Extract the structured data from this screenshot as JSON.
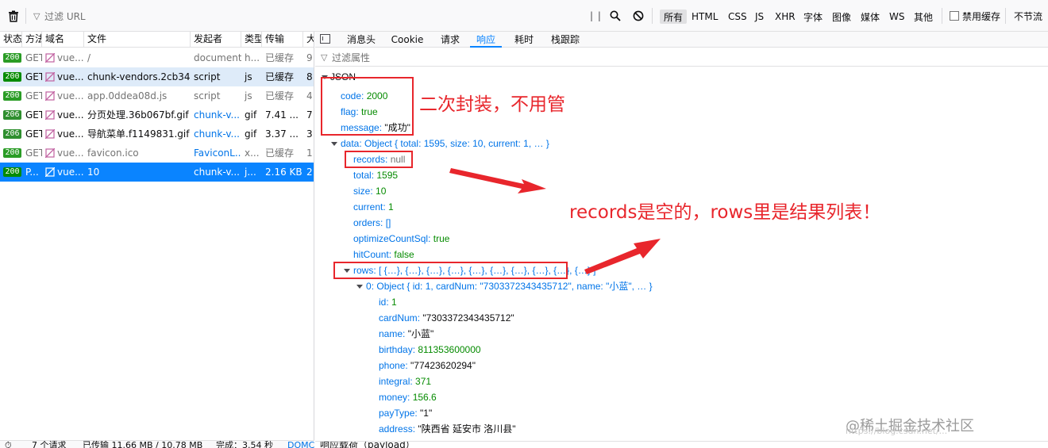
{
  "toolbar": {
    "filter_placeholder": "过滤 URL",
    "types": [
      "所有",
      "HTML",
      "CSS",
      "JS",
      "XHR",
      "字体",
      "图像",
      "媒体",
      "WS",
      "其他"
    ],
    "active_type": "所有",
    "disable_cache": "禁用缓存",
    "throttle": "不节流"
  },
  "table": {
    "headers": [
      "状态",
      "方法",
      "域名",
      "文件",
      "发起者",
      "类型",
      "传输",
      "大小"
    ],
    "rows": [
      {
        "status": "200",
        "method": "GET",
        "domain": "vue...",
        "file": "/",
        "initiator": "document",
        "type": "h...",
        "transfer": "已缓存",
        "size": "9"
      },
      {
        "status": "200",
        "method": "GET",
        "domain": "vue...",
        "file": "chunk-vendors.2cb34c0a.js",
        "initiator": "script",
        "type": "js",
        "transfer": "已缓存",
        "size": "8"
      },
      {
        "status": "200",
        "method": "GET",
        "domain": "vue...",
        "file": "app.0ddea08d.js",
        "initiator": "script",
        "type": "js",
        "transfer": "已缓存",
        "size": "4"
      },
      {
        "status": "206",
        "method": "GET",
        "domain": "vue...",
        "file": "分页处理.36b067bf.gif",
        "initiator": "chunk-v...",
        "type": "gif",
        "transfer": "7.41 ...",
        "size": "7"
      },
      {
        "status": "206",
        "method": "GET",
        "domain": "vue...",
        "file": "导航菜单.f1149831.gif",
        "initiator": "chunk-v...",
        "type": "gif",
        "transfer": "3.37 ...",
        "size": "3"
      },
      {
        "status": "200",
        "method": "GET",
        "domain": "vue...",
        "file": "favicon.ico",
        "initiator": "FaviconL...",
        "type": "x...",
        "transfer": "已缓存",
        "size": "1"
      },
      {
        "status": "200",
        "method": "P...",
        "domain": "vue...",
        "file": "10",
        "initiator": "chunk-v...",
        "type": "j...",
        "transfer": "2.16 KB",
        "size": "2"
      }
    ]
  },
  "statusbar": {
    "requests": "7 个请求",
    "transferred": "已传输 11.66 MB / 10.78 MB",
    "finish": "完成：3.54 秒",
    "domcontent": "DOMC"
  },
  "panel": {
    "tabs": [
      "消息头",
      "Cookie",
      "请求",
      "响应",
      "耗时",
      "栈跟踪"
    ],
    "active_tab": "响应",
    "filter_placeholder": "过滤属性",
    "json_root": "JSON",
    "payload_section": "响应载荷（payload）"
  },
  "json": {
    "code": {
      "key": "code",
      "value": "2000"
    },
    "flag": {
      "key": "flag",
      "value": "true"
    },
    "message": {
      "key": "message",
      "value": "\"成功\""
    },
    "data": {
      "key": "data",
      "value": "Object { total: 1595, size: 10, current: 1, … }"
    },
    "records": {
      "key": "records",
      "value": "null"
    },
    "total": {
      "key": "total",
      "value": "1595"
    },
    "size": {
      "key": "size",
      "value": "10"
    },
    "current": {
      "key": "current",
      "value": "1"
    },
    "orders": {
      "key": "orders",
      "value": "[]"
    },
    "optimizeCountSql": {
      "key": "optimizeCountSql",
      "value": "true"
    },
    "hitCount": {
      "key": "hitCount",
      "value": "false"
    },
    "rows": {
      "key": "rows",
      "value": "[ {…}, {…}, {…}, {…}, {…}, {…}, {…}, {…}, {…}, {…} ]"
    },
    "row0": {
      "key": "0",
      "value": "Object { id: 1, cardNum: \"7303372343435712\", name: \"小蓝\", … }"
    },
    "id": {
      "key": "id",
      "value": "1"
    },
    "cardNum": {
      "key": "cardNum",
      "value": "\"7303372343435712\""
    },
    "name": {
      "key": "name",
      "value": "\"小蓝\""
    },
    "birthday": {
      "key": "birthday",
      "value": "811353600000"
    },
    "phone": {
      "key": "phone",
      "value": "\"77423620294\""
    },
    "integral": {
      "key": "integral",
      "value": "371"
    },
    "money": {
      "key": "money",
      "value": "156.6"
    },
    "payType": {
      "key": "payType",
      "value": "\"1\""
    },
    "address": {
      "key": "address",
      "value": "\"陕西省 延安市 洛川县\""
    }
  },
  "annotations": {
    "note1": "二次封装，不用管",
    "note2": "records是空的，rows里是结果列表！"
  },
  "watermark": {
    "main": "@稀土掘金技术社区",
    "sub": "https://blog.csdn.net/..."
  },
  "colors": {
    "accent": "#0a84ff",
    "annotation": "#e8262c",
    "status_ok": "#058b00",
    "status_partial": "#4a9b2a",
    "json_key": "#0074e8",
    "json_number": "#058b00"
  }
}
